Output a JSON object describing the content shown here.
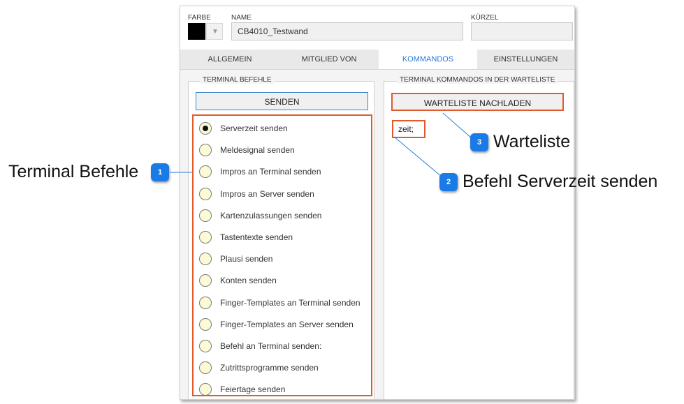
{
  "header": {
    "farbe_label": "FARBE",
    "name_label": "NAME",
    "name_value": "CB4010_Testwand",
    "kurzel_label": "KÜRZEL",
    "kurzel_value": "",
    "color_value": "#000000",
    "dropdown_glyph": "▼"
  },
  "tabs": [
    {
      "label": "ALLGEMEIN",
      "active": false
    },
    {
      "label": "MITGLIED VON",
      "active": false
    },
    {
      "label": "KOMMANDOS",
      "active": true
    },
    {
      "label": "EINSTELLUNGEN",
      "active": false
    }
  ],
  "left_panel": {
    "title": "TERMINAL BEFEHLE",
    "send_button": "SENDEN",
    "options": [
      {
        "label": "Serverzeit senden",
        "selected": true
      },
      {
        "label": "Meldesignal senden",
        "selected": false
      },
      {
        "label": "Impros an Terminal senden",
        "selected": false
      },
      {
        "label": "Impros an Server senden",
        "selected": false
      },
      {
        "label": "Kartenzulassungen senden",
        "selected": false
      },
      {
        "label": "Tastentexte senden",
        "selected": false
      },
      {
        "label": "Plausi senden",
        "selected": false
      },
      {
        "label": "Konten senden",
        "selected": false
      },
      {
        "label": "Finger-Templates an Terminal senden",
        "selected": false
      },
      {
        "label": "Finger-Templates an Server senden",
        "selected": false
      },
      {
        "label": "Befehl an Terminal senden:",
        "selected": false
      },
      {
        "label": "Zutrittsprogramme senden",
        "selected": false
      },
      {
        "label": "Feiertage senden",
        "selected": false
      }
    ]
  },
  "right_panel": {
    "title": "TERMINAL KOMMANDOS IN DER WARTELISTE",
    "reload_button": "WARTELISTE NACHLADEN",
    "queue_text": "zeit;"
  },
  "callouts": [
    {
      "number": "1",
      "text": "Terminal Befehle"
    },
    {
      "number": "2",
      "text": "Befehl Serverzeit senden"
    },
    {
      "number": "3",
      "text": "Warteliste"
    }
  ],
  "colors": {
    "highlight": "#e05a2b",
    "badge": "#1a7be6",
    "active_tab": "#2a7bd3",
    "radio_fill": "#fdfbd6"
  }
}
